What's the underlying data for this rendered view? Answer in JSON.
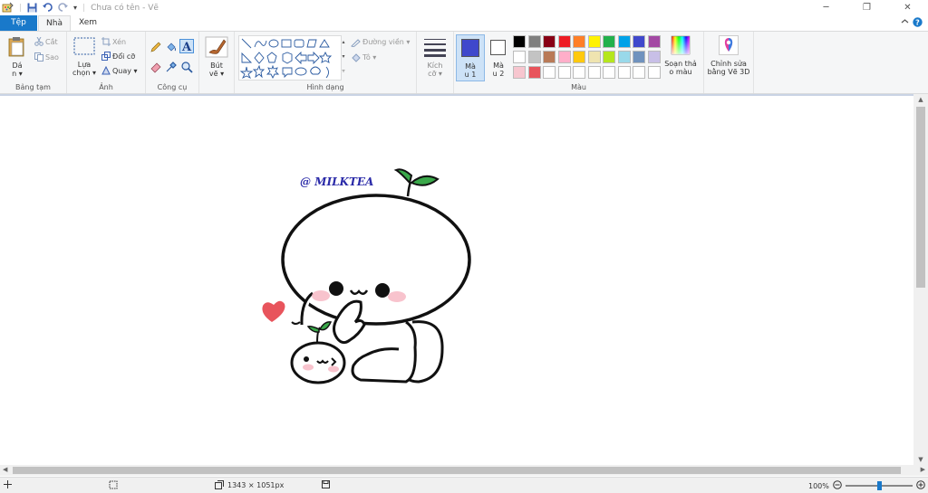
{
  "window": {
    "title": "Chưa có tên - Vẽ",
    "minimize": "─",
    "maximize": "❐",
    "close": "✕"
  },
  "tabs": {
    "file": "Tệp",
    "home": "Nhà",
    "view": "Xem"
  },
  "ribbon": {
    "clipboard": {
      "label": "Bảng tạm",
      "paste_line1": "Dá",
      "paste_line2": "n ▾",
      "cut": "Cắt",
      "copy": "Sao"
    },
    "image": {
      "label": "Ảnh",
      "select_line1": "Lựa",
      "select_line2": "chọn ▾",
      "crop": "Xén",
      "resize": "Đổi cỡ",
      "rotate": "Quay ▾"
    },
    "tools": {
      "label": "Công cụ"
    },
    "brushes": {
      "line1": "Bút",
      "line2": "vẽ ▾"
    },
    "shapes": {
      "label": "Hình dạng",
      "outline": "Đường viền ▾",
      "fill": "Tô ▾"
    },
    "size": {
      "line1": "Kích",
      "line2": "cỡ ▾"
    },
    "colors": {
      "label": "Màu",
      "color1_line1": "Mà",
      "color1_line2": "u 1",
      "color2_line1": "Mà",
      "color2_line2": "u 2",
      "edit_line1": "Soạn thả",
      "edit_line2": "o màu",
      "color1_value": "#3f48cc",
      "color2_value": "#ffffff",
      "palette_row1": [
        "#000000",
        "#7f7f7f",
        "#880015",
        "#ed1c24",
        "#ff7f27",
        "#fff200",
        "#22b14c",
        "#00a2e8",
        "#3f48cc",
        "#a349a4"
      ],
      "palette_row2": [
        "#ffffff",
        "#c3c3c3",
        "#b97a57",
        "#ffaec9",
        "#ffc90e",
        "#efe4b0",
        "#b5e61d",
        "#99d9ea",
        "#7092be",
        "#c8bfe7"
      ],
      "palette_row3": [
        "#f7c6cf",
        "#e8545c",
        "#ffffff",
        "#ffffff",
        "#ffffff",
        "#ffffff",
        "#ffffff",
        "#ffffff",
        "#ffffff",
        "#ffffff"
      ]
    },
    "paint3d": {
      "line1": "Chỉnh sửa",
      "line2": "bằng Vẽ 3D"
    }
  },
  "drawing": {
    "watermark": "@ MILKTEA",
    "face_text": "•ω•"
  },
  "status": {
    "dimensions": "1343 × 1051px",
    "zoom": "100%"
  }
}
